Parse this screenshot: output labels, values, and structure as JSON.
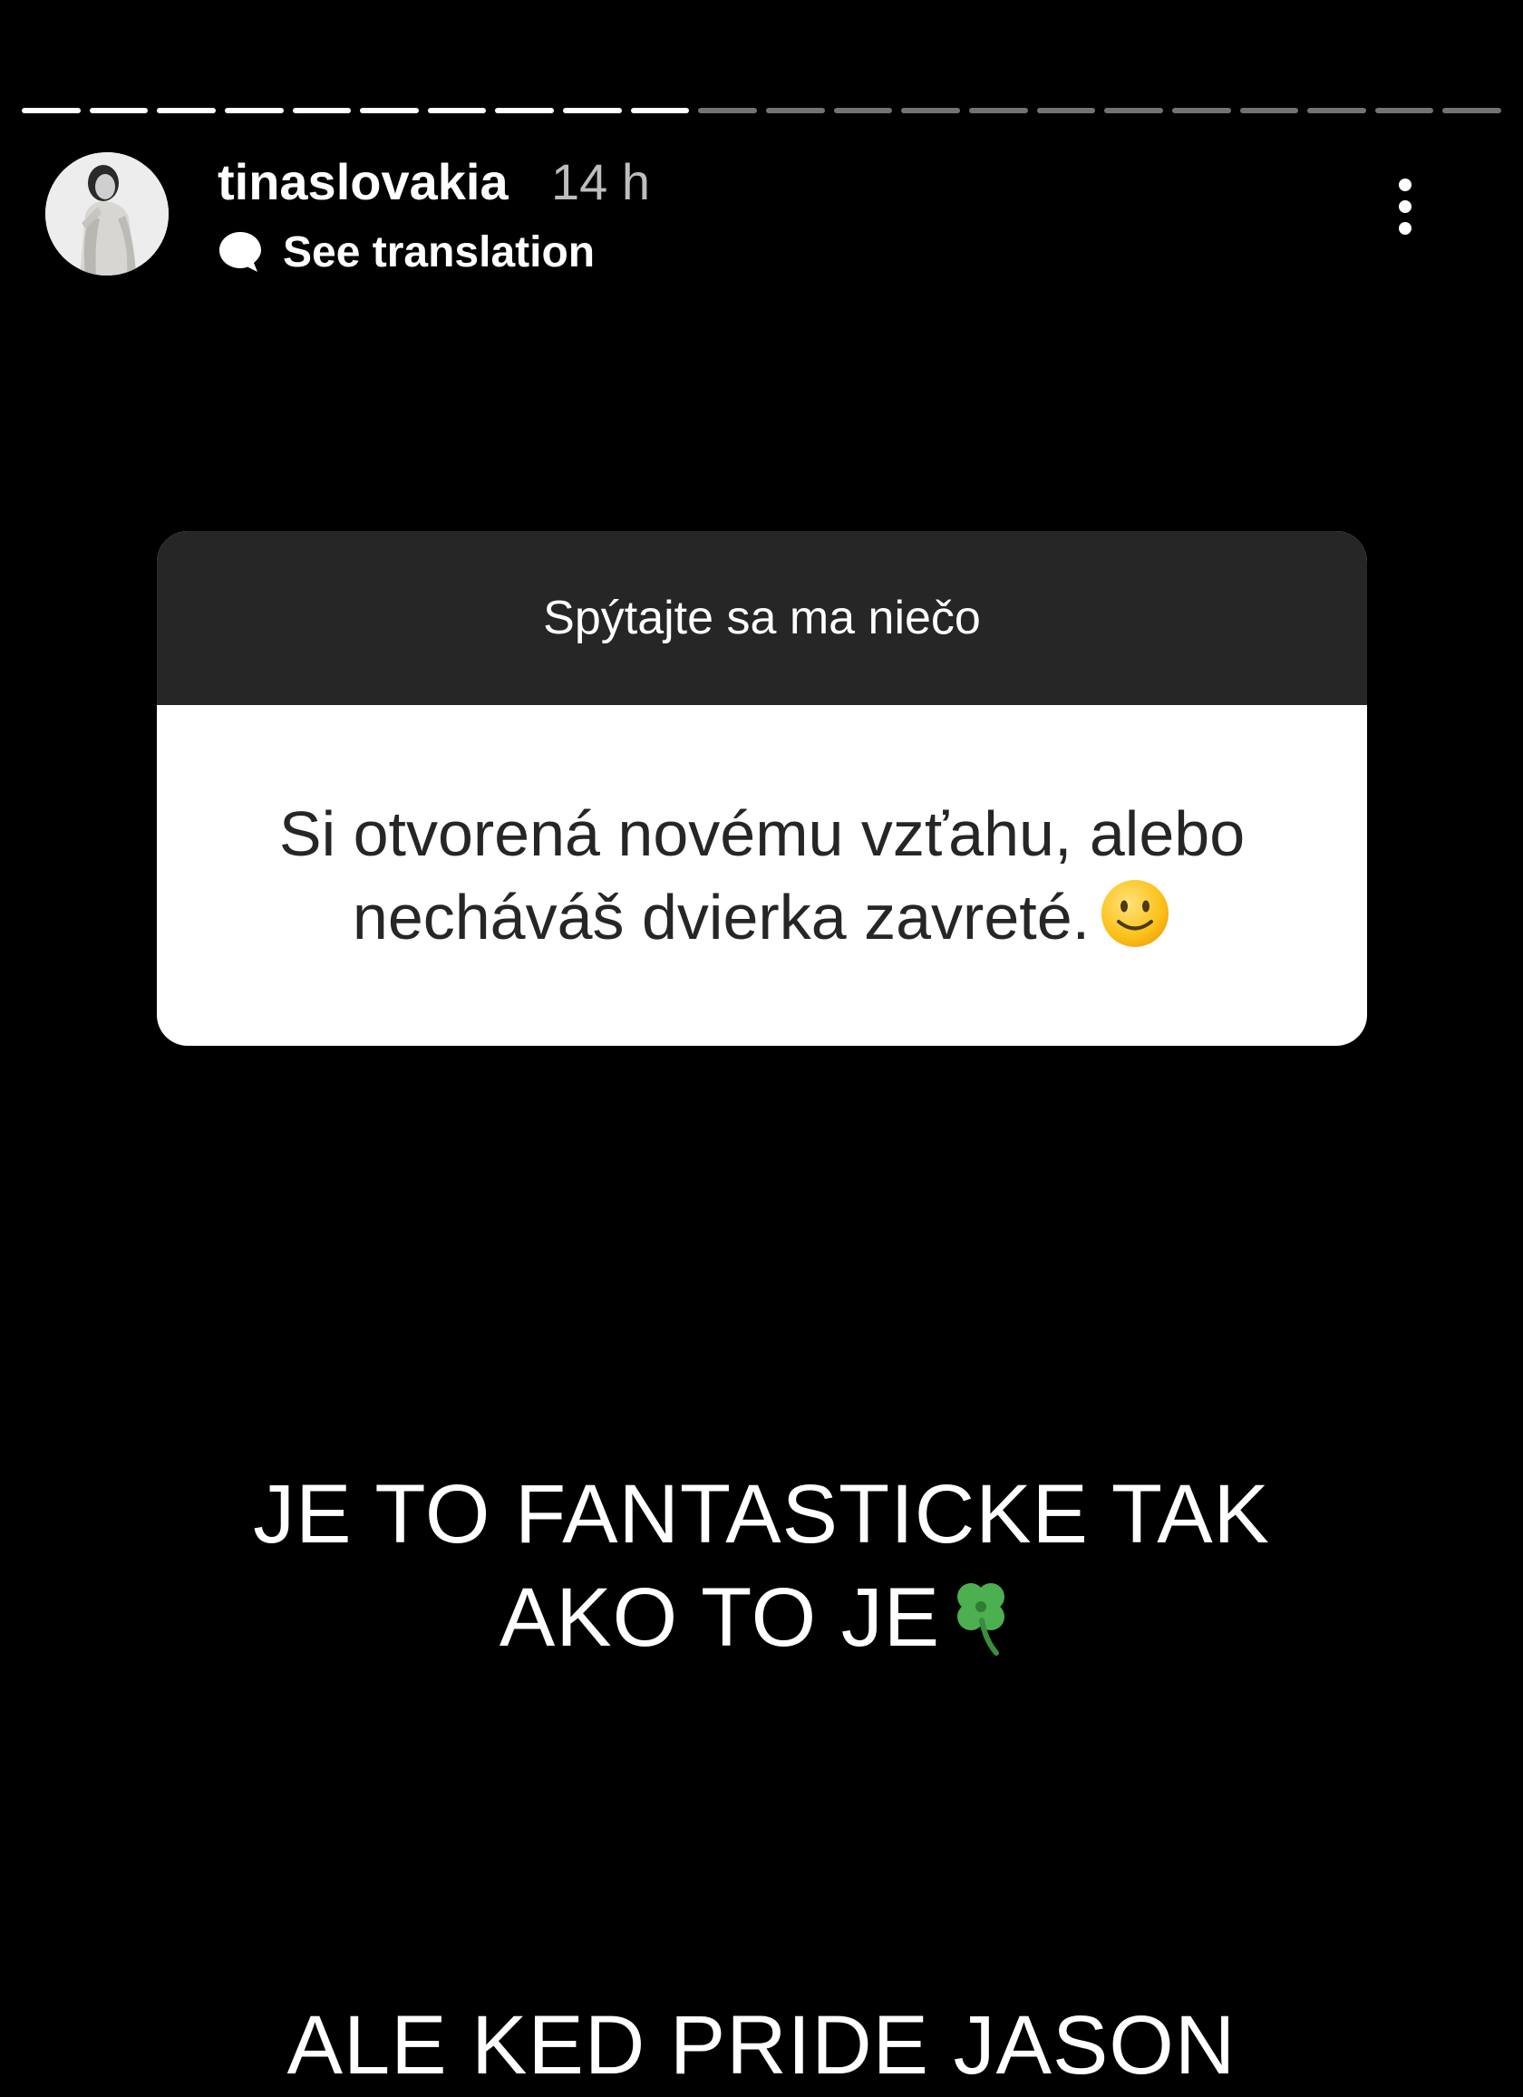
{
  "story": {
    "progress_total": 22,
    "progress_done": 10
  },
  "header": {
    "username": "tinaslovakia",
    "time": "14 h",
    "see_translation": "See translation",
    "avatar_icon": "avatar-photo",
    "translation_icon": "speech-bubble-icon",
    "more_icon": "more-vertical-icon"
  },
  "question_sticker": {
    "title": "Spýtajte sa ma niečo",
    "question": "Si otvorená novému vzťahu, alebo necháváš dvierka zavreté.",
    "emoji": "slightly-smiling-face"
  },
  "captions": {
    "line1": "JE TO FANTASTICKE TAK",
    "line2": "AKO TO JE",
    "line2_emoji": "four-leaf-clover",
    "line3": "ALE KED PRIDE JASON"
  },
  "colors": {
    "background": "#000000",
    "sticker_header": "#262626",
    "sticker_body": "#ffffff",
    "time": "#bdbdbd"
  }
}
